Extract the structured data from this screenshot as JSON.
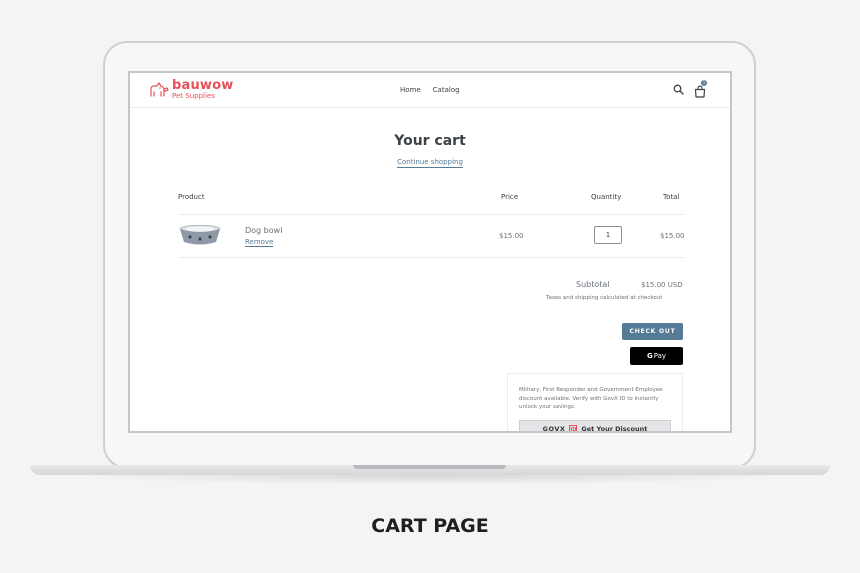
{
  "header": {
    "brand_name": "bauwow",
    "brand_tagline": "Pet Supplies",
    "nav": [
      "Home",
      "Catalog"
    ],
    "cart_count": "1"
  },
  "cart": {
    "title": "Your cart",
    "continue_label": "Continue shopping",
    "columns": {
      "product": "Product",
      "price": "Price",
      "quantity": "Quantity",
      "total": "Total"
    },
    "items": [
      {
        "name": "Dog bowl",
        "remove_label": "Remove",
        "price": "$15.00",
        "quantity": "1",
        "total": "$15.00"
      }
    ],
    "subtotal_label": "Subtotal",
    "subtotal_value": "$15.00 USD",
    "tax_note": "Taxes and shipping calculated at checkout",
    "checkout_label": "CHECK OUT",
    "gpay_label": "Pay",
    "govx_text": "Military, First Responder and Government Employee discount available. Verify with GovX ID to instantly unlock your savings.",
    "govx_logo": "GOVX",
    "govx_mark": "ID",
    "govx_button": "Get Your Discount"
  },
  "caption": "CART PAGE",
  "colors": {
    "brand": "#e8505b",
    "accent": "#557b97"
  }
}
